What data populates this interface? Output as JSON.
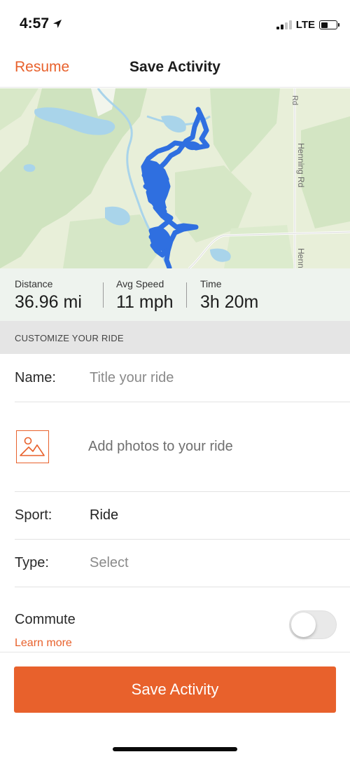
{
  "status_bar": {
    "time": "4:57",
    "network": "LTE",
    "location_icon": "location-arrow-icon",
    "battery_level": 0.45
  },
  "nav": {
    "left_action": "Resume",
    "title": "Save Activity"
  },
  "map": {
    "road_labels": [
      "Rd",
      "Henning Rd",
      "Henn"
    ],
    "route_color": "#2f6fe0"
  },
  "stats": [
    {
      "label": "Distance",
      "value": "36.96 mi"
    },
    {
      "label": "Avg Speed",
      "value": "11 mph"
    },
    {
      "label": "Time",
      "value": "3h 20m"
    }
  ],
  "section_header": "CUSTOMIZE YOUR RIDE",
  "form": {
    "name_label": "Name:",
    "name_placeholder": "Title your ride",
    "photos_text": "Add photos to your ride",
    "photo_icon": "image-icon",
    "sport_label": "Sport:",
    "sport_value": "Ride",
    "type_label": "Type:",
    "type_placeholder": "Select",
    "commute_label": "Commute",
    "commute_enabled": false,
    "learn_more": "Learn more"
  },
  "save_button": "Save Activity",
  "colors": {
    "accent": "#e8612c",
    "route": "#2f6fe0"
  }
}
